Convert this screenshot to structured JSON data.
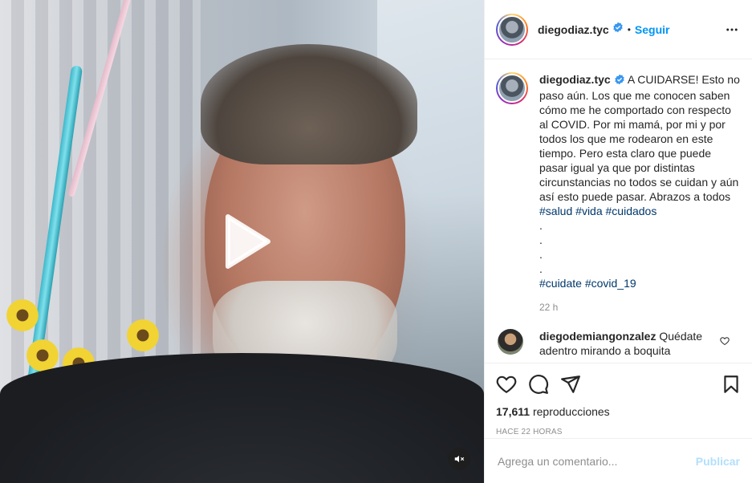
{
  "post": {
    "username": "diegodiaz.tyc",
    "verified": true,
    "follow_label": "Seguir",
    "separator": "•"
  },
  "caption": {
    "username": "diegodiaz.tyc",
    "text": "A CUIDARSE! Esto no paso aún. Los que me conocen saben cómo me he comportado con respecto al COVID. Por mi mamá, por mi y por todos los que me rodearon en este tiempo. Pero esta claro que puede pasar igual ya que por distintas circunstancias no todos se cuidan y aún así esto puede pasar. Abrazos a todos",
    "hashtags1": [
      "#salud",
      "#vida",
      "#cuidados"
    ],
    "dots": [
      ".",
      ".",
      ".",
      "."
    ],
    "hashtags2": [
      "#cuidate",
      "#covid_19"
    ],
    "time": "22 h"
  },
  "comment": {
    "username": "diegodemiangonzalez",
    "text": "Quédate adentro mirando a boquita"
  },
  "stats": {
    "views_count": "17,611",
    "views_label": "reproducciones",
    "time_ago": "HACE 22 HORAS"
  },
  "add_comment": {
    "placeholder": "Agrega un comentario...",
    "publish_label": "Publicar"
  },
  "icons": {
    "more": "more-options-icon",
    "like": "heart-icon",
    "comment": "comment-icon",
    "share": "send-icon",
    "save": "bookmark-icon",
    "play": "play-icon",
    "mute": "speaker-muted-icon"
  },
  "colors": {
    "link_blue": "#0095f6",
    "hashtag": "#00376b",
    "muted_text": "#8e8e8e",
    "publish_disabled": "#b2dffc"
  }
}
